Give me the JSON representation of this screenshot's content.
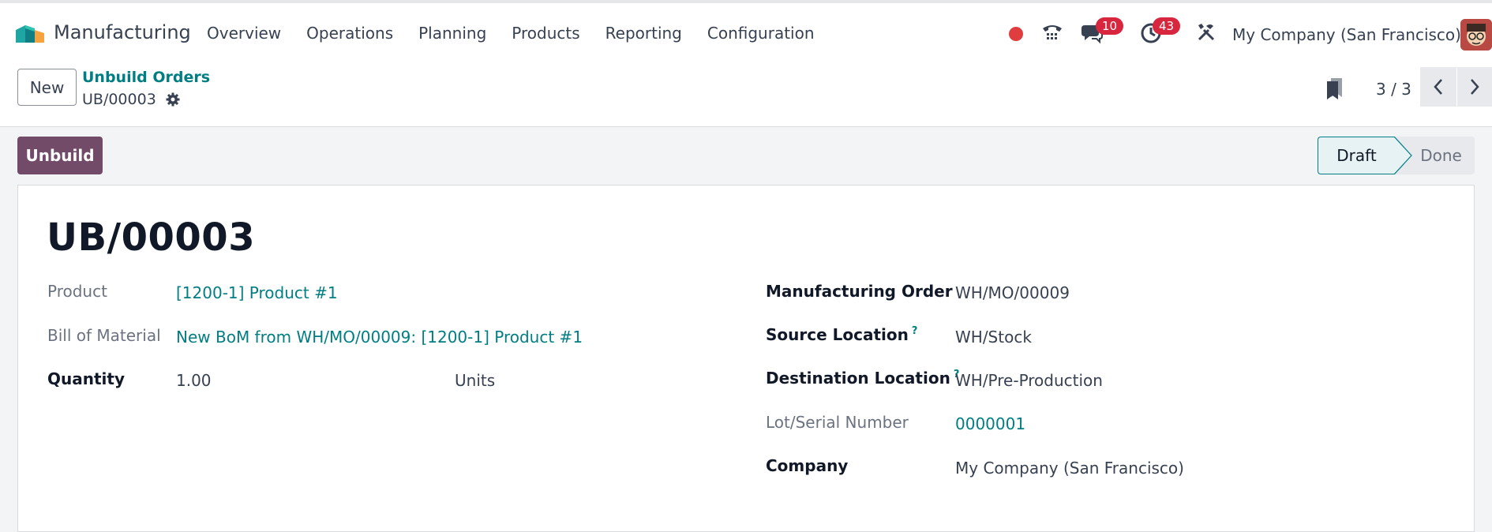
{
  "navbar": {
    "app_name": "Manufacturing",
    "menu": [
      "Overview",
      "Operations",
      "Planning",
      "Products",
      "Reporting",
      "Configuration"
    ],
    "messages_count": "10",
    "activities_count": "43",
    "company": "My Company (San Francisco)"
  },
  "control": {
    "new_label": "New",
    "breadcrumb_parent": "Unbuild Orders",
    "breadcrumb_current": "UB/00003",
    "pager": "3 / 3"
  },
  "statusbar": {
    "action_label": "Unbuild",
    "stages": [
      "Draft",
      "Done"
    ],
    "current_stage": "Draft"
  },
  "form": {
    "title": "UB/00003",
    "left": {
      "product_label": "Product",
      "product_value": "[1200-1] Product #1",
      "bom_label": "Bill of Material",
      "bom_value": "New BoM from WH/MO/00009: [1200-1] Product #1",
      "quantity_label": "Quantity",
      "quantity_value": "1.00",
      "uom_value": "Units"
    },
    "right": {
      "mo_label": "Manufacturing Order",
      "mo_value": "WH/MO/00009",
      "src_label": "Source Location",
      "src_value": "WH/Stock",
      "dest_label": "Destination Location",
      "dest_value": "WH/Pre-Production",
      "lot_label": "Lot/Serial Number",
      "lot_value": "0000001",
      "company_label": "Company",
      "company_value": "My Company (San Francisco)",
      "help_mark": "?"
    }
  },
  "colors": {
    "brand": "#714b67",
    "link": "#017e84",
    "badge": "#d7263d",
    "record": "#e03e3e"
  }
}
